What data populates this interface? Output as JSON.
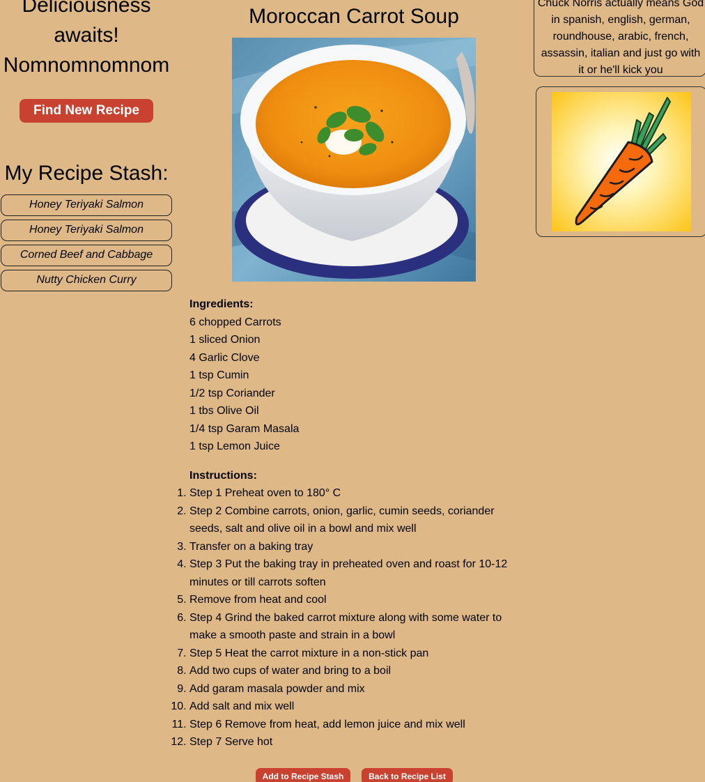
{
  "left": {
    "tagline": "Deliciousness awaits! Nomnomnomnom",
    "find_button": "Find New Recipe",
    "stash_title": "My Recipe Stash:",
    "stash_items": [
      "Honey Teriyaki Salmon",
      "Honey Teriyaki Salmon",
      "Corned Beef and Cabbage",
      "Nutty Chicken Curry"
    ]
  },
  "recipe": {
    "title": "Moroccan Carrot Soup",
    "ingredients_heading": "Ingredients:",
    "ingredients": [
      "6 chopped Carrots",
      "1 sliced Onion",
      "4 Garlic Clove",
      "1 tsp Cumin",
      "1/2 tsp Coriander",
      "1 tbs Olive Oil",
      "1/4 tsp Garam Masala",
      "1 tsp Lemon Juice"
    ],
    "instructions_heading": "Instructions:",
    "steps": [
      "Step 1 Preheat oven to 180° C",
      "Step 2 Combine carrots, onion, garlic, cumin seeds, coriander seeds, salt and olive oil in a bowl and mix well",
      "Transfer on a baking tray",
      "Step 3 Put the baking tray in preheated oven and roast for 10-12 minutes or till carrots soften",
      "Remove from heat and cool",
      "Step 4 Grind the baked carrot mixture along with some water to make a smooth paste and strain in a bowl",
      "Step 5 Heat the carrot mixture in a non-stick pan",
      "Add two cups of water and bring to a boil",
      "Add garam masala powder and mix",
      "Add salt and mix well",
      "Step 6 Remove from heat, add lemon juice and mix well",
      "Step 7 Serve hot"
    ],
    "add_button": "Add to Recipe Stash",
    "back_button": "Back to Recipe List"
  },
  "right": {
    "quote": "Chuck Norris actually means God in spanish, english, german, roundhouse, arabic, french, assassin, italian and just go with it or he'll kick you"
  },
  "colors": {
    "background": "#deb887",
    "button": "#c9412f"
  }
}
